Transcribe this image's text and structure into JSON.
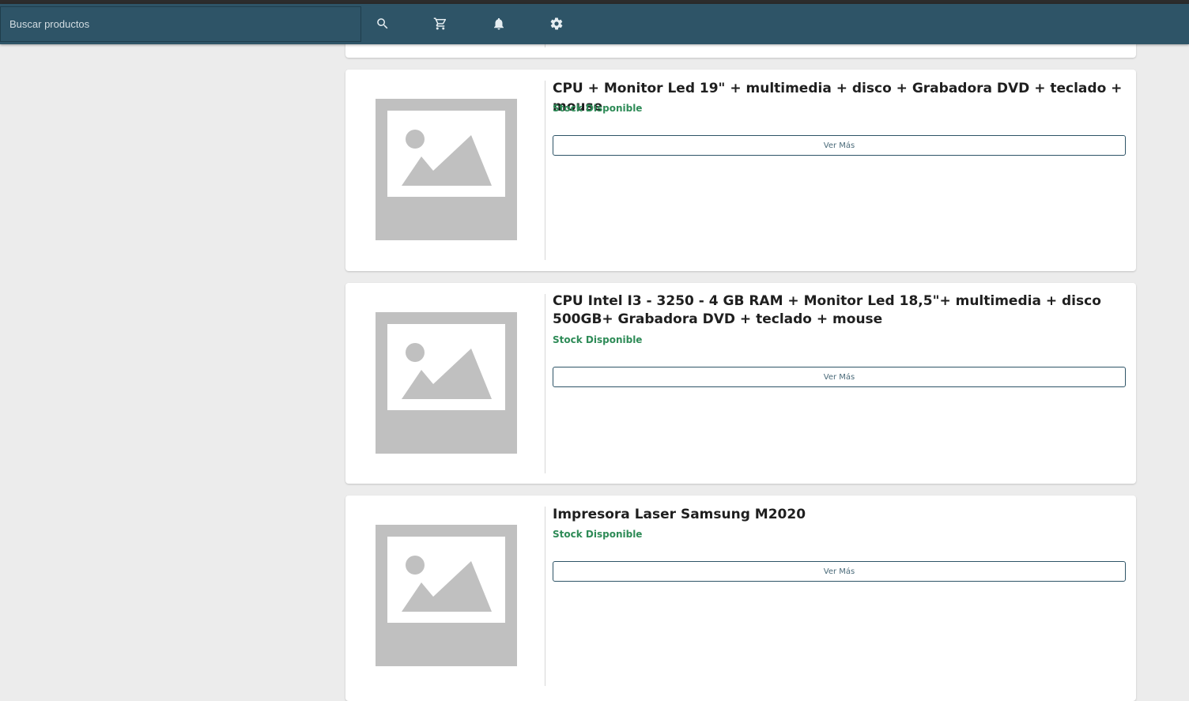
{
  "search": {
    "placeholder": "Buscar productos"
  },
  "navbar": {
    "icons": [
      "search-icon",
      "cart-icon",
      "bell-icon",
      "gear-icon"
    ],
    "background": "#2e5467"
  },
  "products": [
    {
      "title": "CPU + Monitor Led 19\" + multimedia + disco + Grabadora DVD + teclado + mouse",
      "stock": "Stock Disponible",
      "button": "Ver Más"
    },
    {
      "title": "CPU Intel I3 - 3250 - 4 GB RAM + Monitor Led 18,5\"+ multimedia + disco 500GB+ Grabadora DVD + teclado + mouse",
      "stock": "Stock Disponible",
      "button": "Ver Más"
    },
    {
      "title": "Impresora Laser Samsung M2020",
      "stock": "Stock Disponible",
      "button": "Ver Más"
    }
  ],
  "colors": {
    "stock": "#2e8b57",
    "accent": "#2e5467",
    "placeholder_image": "#c0c0c0"
  }
}
